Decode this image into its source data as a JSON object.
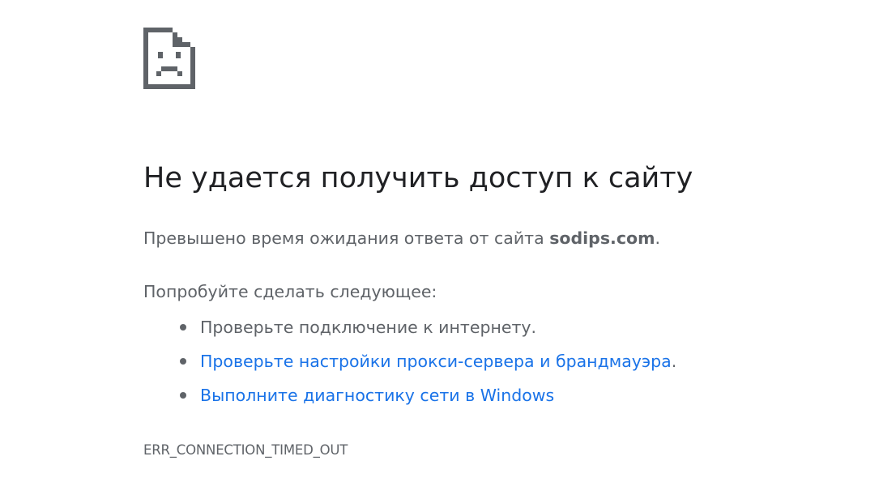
{
  "error_page": {
    "title": "Не удается получить доступ к сайту",
    "summary_prefix": "Превышено время ожидания ответа от сайта ",
    "host": "sodips.com",
    "summary_suffix": ".",
    "suggestions_heading": "Попробуйте сделать следующее:",
    "suggestions": [
      {
        "text": "Проверьте подключение к интернету."
      },
      {
        "link": "Проверьте настройки прокси-сервера и брандмауэра",
        "suffix": "."
      },
      {
        "link": "Выполните диагностику сети в Windows"
      }
    ],
    "error_code": "ERR_CONNECTION_TIMED_OUT"
  },
  "icons": {
    "main": "sad-page-icon"
  },
  "colors": {
    "title": "#202124",
    "text": "#5f6368",
    "link": "#1a73e8",
    "icon": "#5f6368"
  }
}
